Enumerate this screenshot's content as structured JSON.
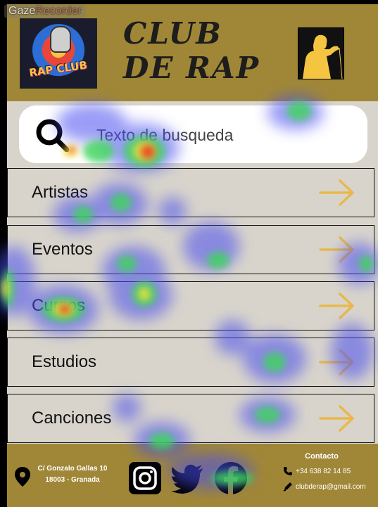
{
  "overlay": {
    "tool_name_prefix": "Gaze",
    "tool_name_suffix": "Recorder"
  },
  "header": {
    "logo_text": "RAP CLUB",
    "title": "CLUB DE RAP"
  },
  "search": {
    "placeholder": "Texto de busqueda"
  },
  "menu": {
    "items": [
      {
        "label": "Artistas"
      },
      {
        "label": "Eventos"
      },
      {
        "label": "Cursos"
      },
      {
        "label": "Estudios"
      },
      {
        "label": "Canciones"
      }
    ]
  },
  "footer": {
    "address_line1": "C/ Gonzalo Gallas 10",
    "address_line2": "18003 - Granada",
    "contact_title": "Contacto",
    "phone": "+34 638 82 14 85",
    "email": "clubderap@gmail.com"
  },
  "colors": {
    "header_bg": "#a08737",
    "page_bg": "#d8d4cb",
    "arrow": "#e8b94a",
    "search_bg": "#ffffff"
  },
  "icons": [
    "search-icon",
    "arrow-right-icon",
    "location-pin-icon",
    "instagram-icon",
    "twitter-icon",
    "facebook-icon",
    "phone-icon",
    "pen-icon"
  ]
}
